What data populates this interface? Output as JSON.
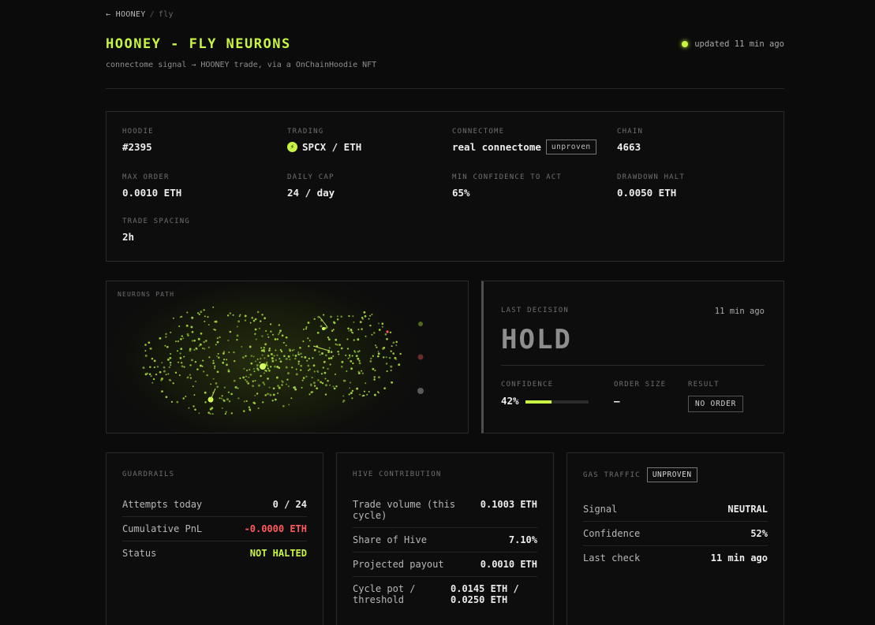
{
  "breadcrumb": {
    "back": "← HOONEY",
    "sep": "/",
    "current": "fly"
  },
  "title": "HOONEY - FLY NEURONS",
  "subtitle": "connectome signal → HOONEY trade, via a OnChainHoodie NFT",
  "updated": "updated 11 min ago",
  "colors": {
    "accent": "#c8f542",
    "negative": "#ff5a5a",
    "background": "#0b0b0b"
  },
  "info": {
    "hoodie": {
      "label": "HOODIE",
      "value": "#2395"
    },
    "trading": {
      "label": "TRADING",
      "value": "SPCX / ETH",
      "icon": "coin-icon"
    },
    "connectome": {
      "label": "CONNECTOME",
      "value": "real connectome",
      "tag": "unproven"
    },
    "chain": {
      "label": "CHAIN",
      "value": "4663"
    },
    "max_order": {
      "label": "MAX ORDER",
      "value": "0.0010 ETH"
    },
    "daily_cap": {
      "label": "DAILY CAP",
      "value": "24 / day"
    },
    "min_conf": {
      "label": "MIN CONFIDENCE TO ACT",
      "value": "65%"
    },
    "drawdown": {
      "label": "DRAWDOWN HALT",
      "value": "0.0050 ETH"
    },
    "spacing": {
      "label": "TRADE SPACING",
      "value": "2h"
    }
  },
  "neurons": {
    "label": "NEURONS PATH"
  },
  "decision": {
    "label": "LAST DECISION",
    "ago": "11 min ago",
    "action": "HOLD",
    "confidence_label": "CONFIDENCE",
    "confidence_value": "42%",
    "confidence_fraction": 0.42,
    "order_label": "ORDER SIZE",
    "order_value": "—",
    "result_label": "RESULT",
    "result_value": "NO ORDER"
  },
  "guardrails": {
    "label": "GUARDRAILS",
    "rows": [
      {
        "k": "Attempts today",
        "v": "0 / 24"
      },
      {
        "k": "Cumulative PnL",
        "v": "-0.0000 ETH"
      },
      {
        "k": "Status",
        "v": "NOT HALTED"
      }
    ]
  },
  "hive": {
    "label": "HIVE CONTRIBUTION",
    "rows": [
      {
        "k": "Trade volume (this cycle)",
        "v": "0.1003 ETH"
      },
      {
        "k": "Share of Hive",
        "v": "7.10%"
      },
      {
        "k": "Projected payout",
        "v": "0.0010 ETH"
      },
      {
        "k": "Cycle pot / threshold",
        "v": "0.0145 ETH / 0.0250 ETH"
      }
    ]
  },
  "gas": {
    "label": "GAS TRAFFIC",
    "tag": "UNPROVEN",
    "rows": [
      {
        "k": "Signal",
        "v": "NEUTRAL"
      },
      {
        "k": "Confidence",
        "v": "52%"
      },
      {
        "k": "Last check",
        "v": "11 min ago"
      }
    ]
  }
}
